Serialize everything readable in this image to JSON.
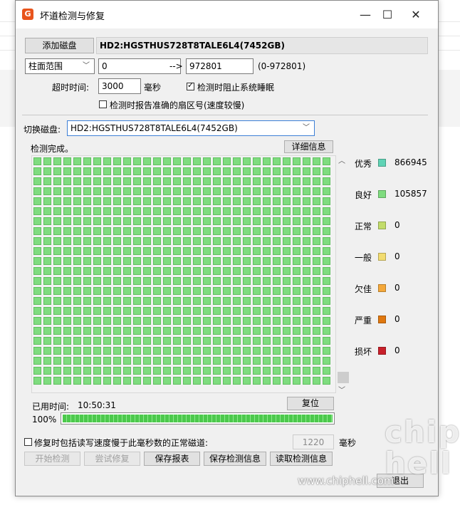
{
  "window": {
    "title": "坏道检测与修复",
    "app_icon_letter": "G"
  },
  "toolbar": {
    "add_disk_label": "添加磁盘",
    "disk_name": "HD2:HGSTHUS728T8TALE6L4(7452GB)"
  },
  "range": {
    "mode_selected": "柱面范围",
    "start": "0",
    "arrow": "-->",
    "end": "972801",
    "hint": "(0-972801)"
  },
  "timeout": {
    "label": "超时时间:",
    "value": "3000",
    "unit": "毫秒"
  },
  "options": {
    "prevent_sleep_label": "检测时阻止系统睡眠",
    "prevent_sleep_checked": true,
    "report_sector_label": "检测时报告准确的扇区号(速度较慢)",
    "report_sector_checked": false
  },
  "switch_disk": {
    "label": "切换磁盘:",
    "selected": "HD2:HGSTHUS728T8TALE6L4(7452GB)"
  },
  "status": {
    "text": "检测完成。",
    "details_button": "详细信息"
  },
  "legend": [
    {
      "label": "优秀",
      "color": "#5fd3b5",
      "count": "866945"
    },
    {
      "label": "良好",
      "color": "#7fdc7f",
      "count": "105857"
    },
    {
      "label": "正常",
      "color": "#c2dc6a",
      "count": "0"
    },
    {
      "label": "一般",
      "color": "#f2dc70",
      "count": "0"
    },
    {
      "label": "欠佳",
      "color": "#f4a83a",
      "count": "0"
    },
    {
      "label": "严重",
      "color": "#e0780f",
      "count": "0"
    },
    {
      "label": "损坏",
      "color": "#c8202a",
      "count": "0"
    }
  ],
  "elapsed": {
    "label": "已用时间:",
    "value": "10:50:31",
    "reset_button": "复位"
  },
  "progress": {
    "percent_label": "100%",
    "value": 1.0
  },
  "repair": {
    "label": "修复时包括读写速度慢于此毫秒数的正常磁道:",
    "checked": false,
    "value": "1220",
    "unit": "毫秒"
  },
  "buttons": {
    "start": "开始检测",
    "try_repair": "尝试修复",
    "save_report": "保存报表",
    "save_info": "保存检测信息",
    "read_info": "读取检测信息",
    "exit": "退出"
  },
  "watermark": {
    "url": "www.chiphell.com",
    "logo_text": "chip hell"
  }
}
